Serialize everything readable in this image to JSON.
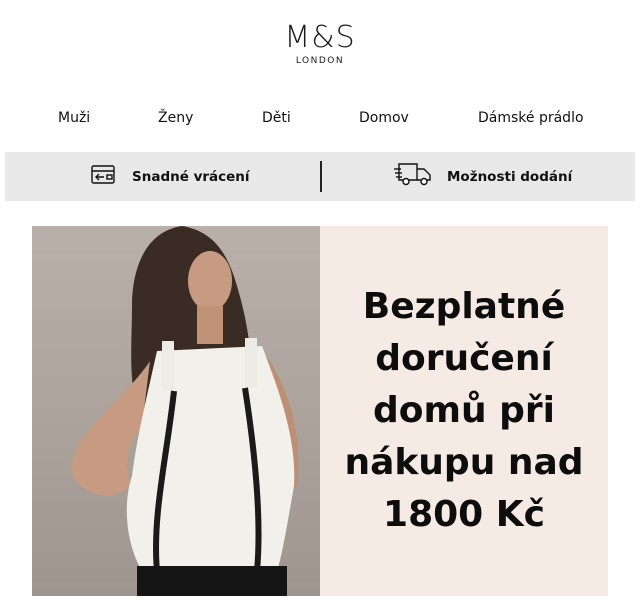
{
  "brand": {
    "logo_text": "M&S",
    "logo_subtext": "LONDON"
  },
  "nav": {
    "items": [
      {
        "label": "Muži"
      },
      {
        "label": "Ženy"
      },
      {
        "label": "Děti"
      },
      {
        "label": "Domov"
      },
      {
        "label": "Dámské prádlo"
      }
    ]
  },
  "services": {
    "returns": {
      "label": "Snadné vrácení",
      "icon": "return-box-icon"
    },
    "delivery": {
      "label": "Možnosti dodání",
      "icon": "delivery-truck-icon"
    }
  },
  "hero": {
    "headline_lines": [
      "Bezplatné",
      "doručení",
      "domů při",
      "nákupu nad",
      "1800 Kč"
    ],
    "image": "woman-white-top-photo",
    "panel_color": "#f5ebe4"
  }
}
